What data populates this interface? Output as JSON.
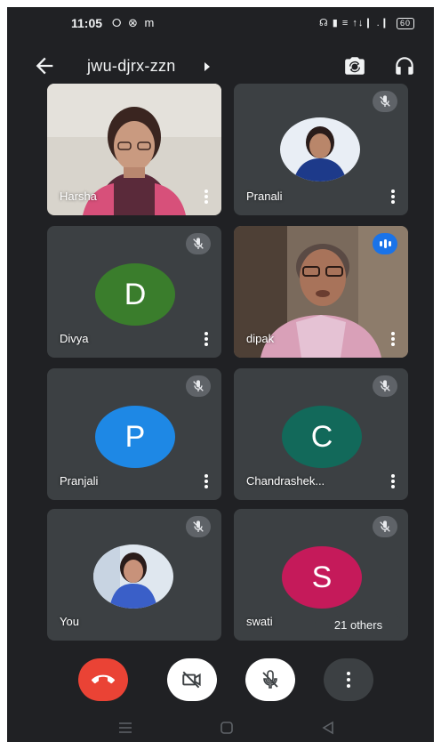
{
  "status_bar": {
    "time": "11:05",
    "left_icons": "⭘ ⊗ m",
    "right_icons": "☊ ▮ ≡ ↑↓❙ .❙",
    "battery": "60"
  },
  "header": {
    "meeting_code": "jwu-djrx-zzn"
  },
  "participants": [
    {
      "name": "Harsha",
      "muted": false,
      "type": "video"
    },
    {
      "name": "Pranali",
      "muted": true,
      "type": "photo"
    },
    {
      "name": "Divya",
      "muted": true,
      "type": "letter",
      "letter": "D",
      "color": "#3a7d2c"
    },
    {
      "name": "dipak",
      "muted": false,
      "speaking": true,
      "type": "video"
    },
    {
      "name": "Pranjali",
      "muted": true,
      "type": "letter",
      "letter": "P",
      "color": "#1e88e5"
    },
    {
      "name": "Chandrashek...",
      "muted": true,
      "type": "letter",
      "letter": "C",
      "color": "#12695a"
    },
    {
      "name": "You",
      "muted": true,
      "type": "photo"
    },
    {
      "name": "swati",
      "muted": true,
      "type": "letter",
      "letter": "S",
      "color": "#c51a5a"
    }
  ],
  "others_label": "21 others",
  "colors": {
    "background": "#202124",
    "tile": "#3c4043",
    "end_call": "#ea4335",
    "speaking": "#1a73e8"
  }
}
